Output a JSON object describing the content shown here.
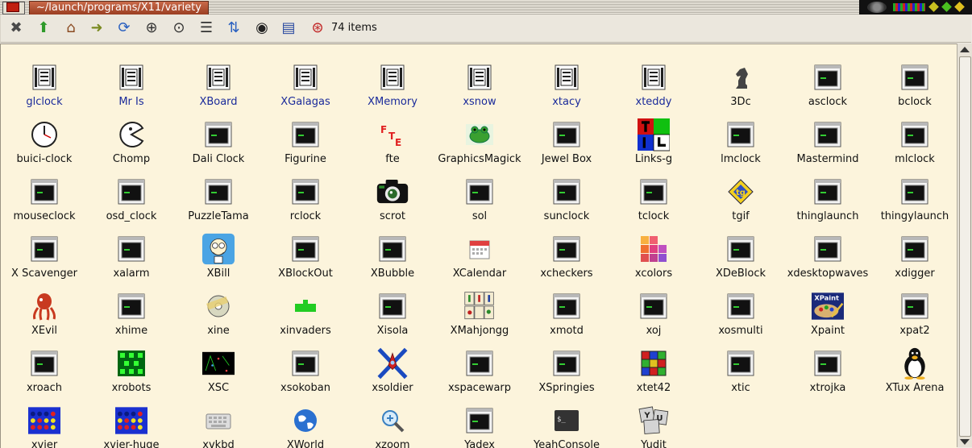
{
  "window": {
    "title": "~/launch/programs/X11/variety"
  },
  "toolbar": {
    "buttons": [
      {
        "name": "close-button",
        "icon": "close-icon",
        "glyph": "✖",
        "color": "#4a4a4a"
      },
      {
        "name": "parent-dir-button",
        "icon": "up-arrow-icon",
        "glyph": "⬆",
        "color": "#2f9a2a"
      },
      {
        "name": "home-button",
        "icon": "home-icon",
        "glyph": "⌂",
        "color": "#8a4a20"
      },
      {
        "name": "go-button",
        "icon": "key-arrow-icon",
        "glyph": "➜",
        "color": "#7a8a20"
      },
      {
        "name": "refresh-button",
        "icon": "refresh-icon",
        "glyph": "⟳",
        "color": "#2a60c0"
      },
      {
        "name": "zoom-in-button",
        "icon": "zoom-in-icon",
        "glyph": "⊕",
        "color": "#333333"
      },
      {
        "name": "zoom-fit-button",
        "icon": "zoom-fit-icon",
        "glyph": "⊙",
        "color": "#333333"
      },
      {
        "name": "details-view-button",
        "icon": "list-icon",
        "glyph": "☰",
        "color": "#333333"
      },
      {
        "name": "sort-button",
        "icon": "sort-az-icon",
        "glyph": "⇅",
        "color": "#2a60c0"
      },
      {
        "name": "show-hidden-button",
        "icon": "eye-icon",
        "glyph": "◉",
        "color": "#222222"
      },
      {
        "name": "select-button",
        "icon": "select-icon",
        "glyph": "▤",
        "color": "#2a4aa0"
      },
      {
        "name": "help-button",
        "icon": "lifebuoy-icon",
        "glyph": "⊛",
        "color": "#c02020"
      }
    ],
    "items_count": "74 items"
  },
  "items": [
    {
      "label": "glclock",
      "icon": "terminal-doc-icon",
      "link": true
    },
    {
      "label": "Mr Is",
      "icon": "terminal-doc-icon",
      "link": true
    },
    {
      "label": "XBoard",
      "icon": "terminal-doc-icon",
      "link": true
    },
    {
      "label": "XGalagas",
      "icon": "terminal-doc-icon",
      "link": true
    },
    {
      "label": "XMemory",
      "icon": "terminal-doc-icon",
      "link": true
    },
    {
      "label": "xsnow",
      "icon": "terminal-doc-icon",
      "link": true
    },
    {
      "label": "xtacy",
      "icon": "terminal-doc-icon",
      "link": true
    },
    {
      "label": "xteddy",
      "icon": "terminal-doc-icon",
      "link": true
    },
    {
      "label": "3Dc",
      "icon": "chess-knight-icon",
      "link": false
    },
    {
      "label": "asclock",
      "icon": "terminal-window-icon",
      "link": false
    },
    {
      "label": "bclock",
      "icon": "terminal-window-icon",
      "link": false
    },
    {
      "label": "buici-clock",
      "icon": "clock-icon",
      "link": false
    },
    {
      "label": "Chomp",
      "icon": "pacman-icon",
      "link": false
    },
    {
      "label": "Dali Clock",
      "icon": "terminal-window-icon",
      "link": false
    },
    {
      "label": "Figurine",
      "icon": "terminal-window-icon",
      "link": false
    },
    {
      "label": "fte",
      "icon": "fte-logo-icon",
      "link": false
    },
    {
      "label": "GraphicsMagick",
      "icon": "frog-icon",
      "link": false
    },
    {
      "label": "Jewel Box",
      "icon": "terminal-window-icon",
      "link": false
    },
    {
      "label": "Links-g",
      "icon": "links-logo-icon",
      "link": false
    },
    {
      "label": "lmclock",
      "icon": "terminal-window-icon",
      "link": false
    },
    {
      "label": "Mastermind",
      "icon": "terminal-window-icon",
      "link": false
    },
    {
      "label": "mlclock",
      "icon": "terminal-window-icon",
      "link": false
    },
    {
      "label": "mouseclock",
      "icon": "terminal-window-icon",
      "link": false
    },
    {
      "label": "osd_clock",
      "icon": "terminal-window-icon",
      "link": false
    },
    {
      "label": "PuzzleTama",
      "icon": "terminal-window-icon",
      "link": false
    },
    {
      "label": "rclock",
      "icon": "terminal-window-icon",
      "link": false
    },
    {
      "label": "scrot",
      "icon": "camera-icon",
      "link": false
    },
    {
      "label": "sol",
      "icon": "terminal-window-icon",
      "link": false
    },
    {
      "label": "sunclock",
      "icon": "terminal-window-icon",
      "link": false
    },
    {
      "label": "tclock",
      "icon": "terminal-window-icon",
      "link": false
    },
    {
      "label": "tgif",
      "icon": "tgif-logo-icon",
      "link": false
    },
    {
      "label": "thinglaunch",
      "icon": "terminal-window-icon",
      "link": false
    },
    {
      "label": "thingylaunch",
      "icon": "terminal-window-icon",
      "link": false
    },
    {
      "label": "X Scavenger",
      "icon": "terminal-window-icon",
      "link": false
    },
    {
      "label": "xalarm",
      "icon": "terminal-window-icon",
      "link": false
    },
    {
      "label": "XBill",
      "icon": "xbill-icon",
      "link": false
    },
    {
      "label": "XBlockOut",
      "icon": "terminal-window-icon",
      "link": false
    },
    {
      "label": "XBubble",
      "icon": "terminal-window-icon",
      "link": false
    },
    {
      "label": "XCalendar",
      "icon": "calendar-icon",
      "link": false
    },
    {
      "label": "xcheckers",
      "icon": "terminal-window-icon",
      "link": false
    },
    {
      "label": "xcolors",
      "icon": "color-palette-icon",
      "link": false
    },
    {
      "label": "XDeBlock",
      "icon": "terminal-window-icon",
      "link": false
    },
    {
      "label": "xdesktopwaves",
      "icon": "terminal-window-icon",
      "link": false
    },
    {
      "label": "xdigger",
      "icon": "terminal-window-icon",
      "link": false
    },
    {
      "label": "XEvil",
      "icon": "octopus-icon",
      "link": false
    },
    {
      "label": "xhime",
      "icon": "terminal-window-icon",
      "link": false
    },
    {
      "label": "xine",
      "icon": "xine-icon",
      "link": false
    },
    {
      "label": "xinvaders",
      "icon": "invader-cannon-icon",
      "link": false
    },
    {
      "label": "Xisola",
      "icon": "terminal-window-icon",
      "link": false
    },
    {
      "label": "XMahjongg",
      "icon": "mahjong-tiles-icon",
      "link": false
    },
    {
      "label": "xmotd",
      "icon": "terminal-window-icon",
      "link": false
    },
    {
      "label": "xoj",
      "icon": "terminal-window-icon",
      "link": false
    },
    {
      "label": "xosmulti",
      "icon": "terminal-window-icon",
      "link": false
    },
    {
      "label": "Xpaint",
      "icon": "xpaint-icon",
      "link": false
    },
    {
      "label": "xpat2",
      "icon": "terminal-window-icon",
      "link": false
    },
    {
      "label": "xroach",
      "icon": "terminal-window-icon",
      "link": false
    },
    {
      "label": "xrobots",
      "icon": "robots-icon",
      "link": false
    },
    {
      "label": "XSC",
      "icon": "xsc-icon",
      "link": false
    },
    {
      "label": "xsokoban",
      "icon": "terminal-window-icon",
      "link": false
    },
    {
      "label": "xsoldier",
      "icon": "xsoldier-icon",
      "link": false
    },
    {
      "label": "xspacewarp",
      "icon": "terminal-window-icon",
      "link": false
    },
    {
      "label": "XSpringies",
      "icon": "terminal-window-icon",
      "link": false
    },
    {
      "label": "xtet42",
      "icon": "tetris-blocks-icon",
      "link": false
    },
    {
      "label": "xtic",
      "icon": "terminal-window-icon",
      "link": false
    },
    {
      "label": "xtrojka",
      "icon": "terminal-window-icon",
      "link": false
    },
    {
      "label": "XTux Arena",
      "icon": "tux-penguin-icon",
      "link": false
    },
    {
      "label": "xvier",
      "icon": "connect-four-icon",
      "link": false
    },
    {
      "label": "xvier-huge",
      "icon": "connect-four-icon",
      "link": false
    },
    {
      "label": "xvkbd",
      "icon": "keyboard-icon",
      "link": false
    },
    {
      "label": "XWorld",
      "icon": "globe-icon",
      "link": false
    },
    {
      "label": "xzoom",
      "icon": "magnifier-icon",
      "link": false
    },
    {
      "label": "Yadex",
      "icon": "terminal-window-icon",
      "link": false
    },
    {
      "label": "YeahConsole",
      "icon": "console-icon",
      "link": false
    },
    {
      "label": "Yudit",
      "icon": "yudit-icon",
      "link": false
    }
  ]
}
